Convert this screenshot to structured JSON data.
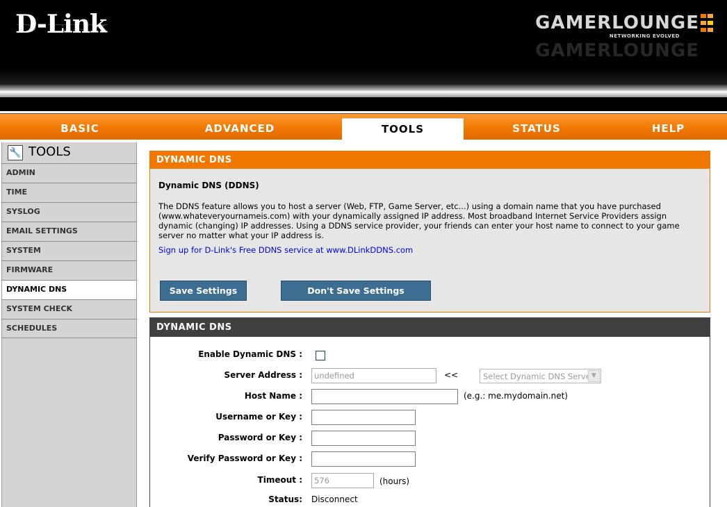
{
  "header": {
    "logo": "D-Link",
    "brand": "GAMERLOUNGE",
    "brand_tagline": "NETWORKING EVOLVED"
  },
  "tabs": [
    {
      "label": "BASIC"
    },
    {
      "label": "ADVANCED"
    },
    {
      "label": "TOOLS",
      "active": true
    },
    {
      "label": "STATUS"
    },
    {
      "label": "HELP"
    }
  ],
  "sidebar": {
    "title": "TOOLS",
    "items": [
      {
        "label": "ADMIN"
      },
      {
        "label": "TIME"
      },
      {
        "label": "SYSLOG"
      },
      {
        "label": "EMAIL SETTINGS"
      },
      {
        "label": "SYSTEM"
      },
      {
        "label": "FIRMWARE"
      },
      {
        "label": "DYNAMIC DNS",
        "active": true
      },
      {
        "label": "SYSTEM CHECK"
      },
      {
        "label": "SCHEDULES"
      }
    ]
  },
  "intro": {
    "bar_title": "DYNAMIC DNS",
    "subtitle": "Dynamic DNS (DDNS)",
    "description": "The DDNS feature allows you to host a server (Web, FTP, Game Server, etc...) using a domain name that you have purchased (www.whateveryournameis.com) with your dynamically assigned IP address. Most broadband Internet Service Providers assign dynamic (changing) IP addresses. Using a DDNS service provider, your friends can enter your host name to connect to your game server no matter what your IP address is.",
    "signup_link": "Sign up for D-Link's Free DDNS service at www.DLinkDDNS.com",
    "save_label": "Save Settings",
    "dont_save_label": "Don't Save Settings"
  },
  "form": {
    "bar_title": "DYNAMIC DNS",
    "enable_label": "Enable Dynamic DNS :",
    "server_label": "Server Address :",
    "server_value": "undefined",
    "server_arrows": "<<",
    "server_select": "Select Dynamic DNS Server",
    "host_label": "Host Name :",
    "host_value": "",
    "host_hint": "(e.g.: me.mydomain.net)",
    "user_label": "Username or Key :",
    "pass_label": "Password or Key :",
    "verify_label": "Verify Password or Key :",
    "timeout_label": "Timeout :",
    "timeout_value": "576",
    "timeout_unit": "(hours)",
    "status_label": "Status:",
    "status_value": "Disconnect"
  },
  "colors": {
    "accent": "#f07800",
    "button": "#3c6e91",
    "dark_bar": "#404040",
    "sidebar": "#d4d4d4"
  }
}
